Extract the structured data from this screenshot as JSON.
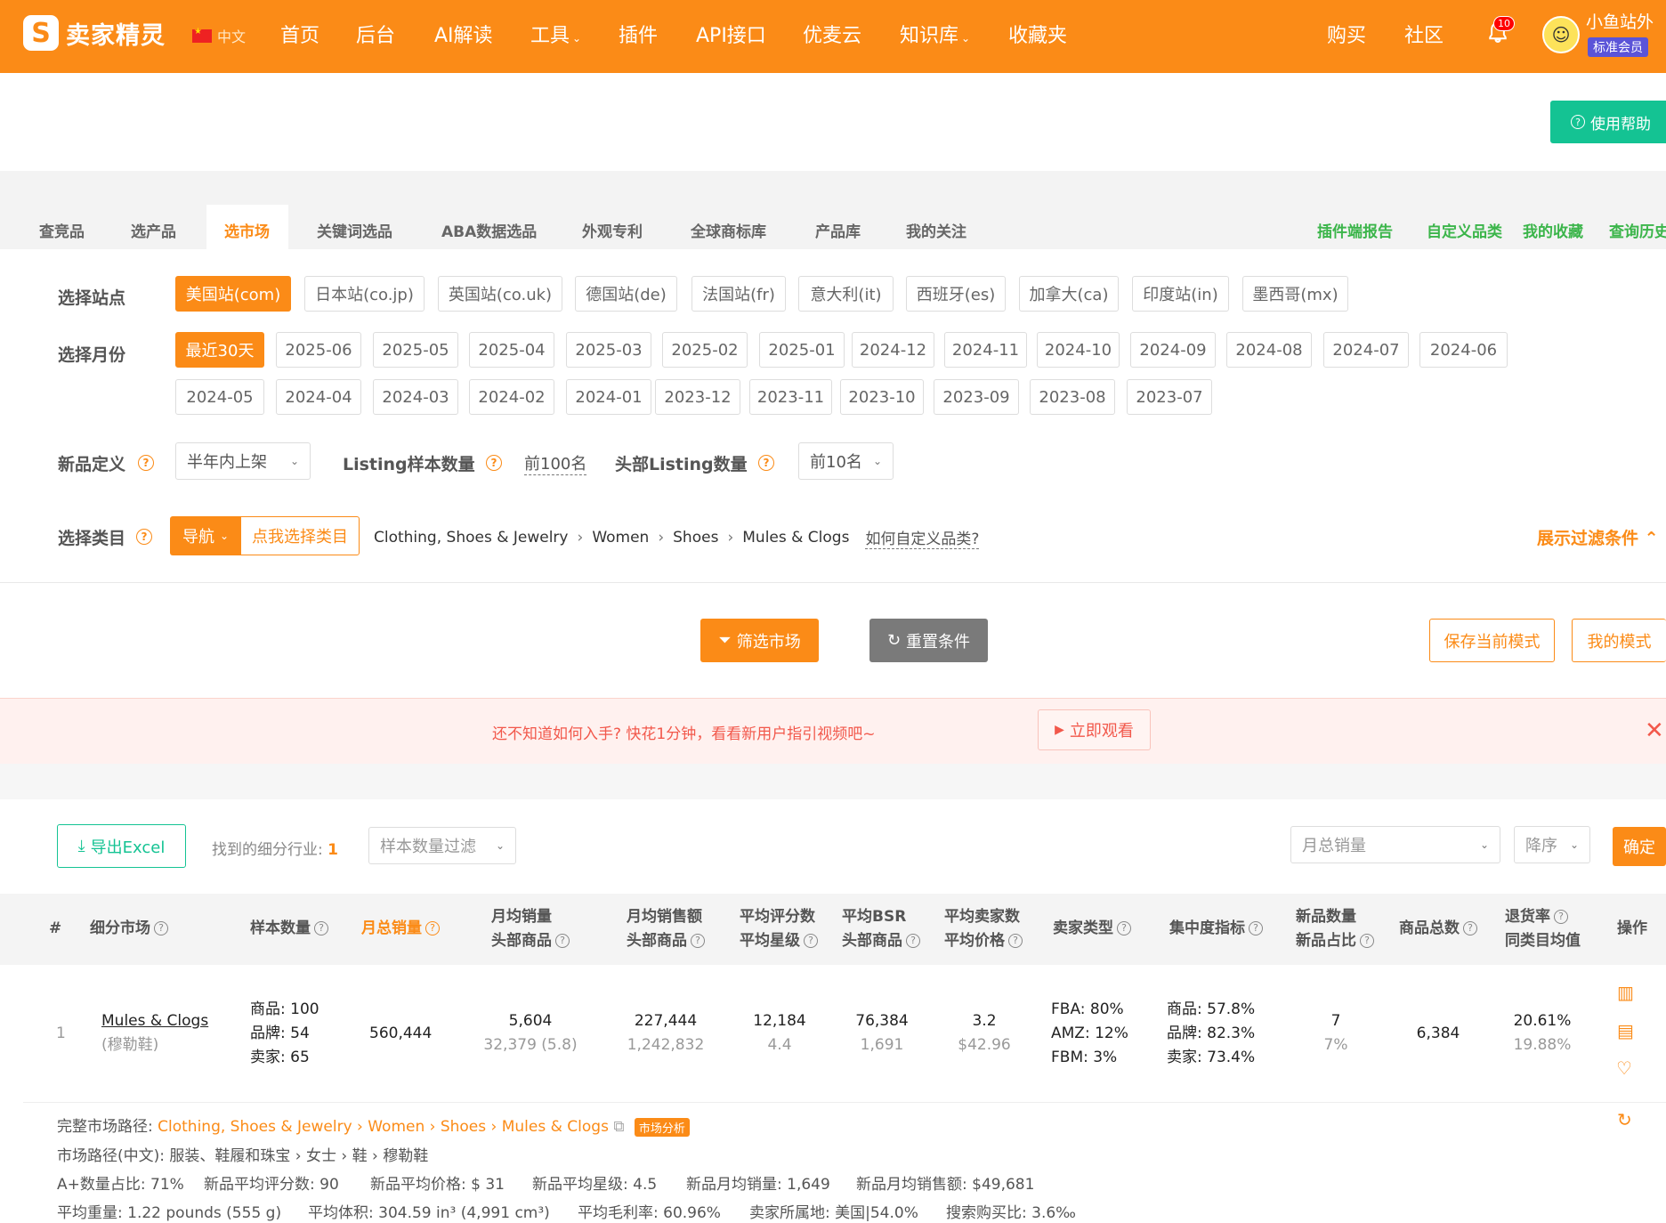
{
  "brand": {
    "name": "卖家精灵",
    "logo_glyph": "S"
  },
  "lang": "中文",
  "nav": {
    "home": "首页",
    "backend": "后台",
    "ai": "AI解读",
    "tools": "工具",
    "plugins": "插件",
    "api": "API接口",
    "youmai": "优麦云",
    "kb": "知识库",
    "favorites": "收藏夹",
    "buy": "购买",
    "community": "社区",
    "notifications": "10",
    "user": "小鱼站外",
    "member": "标准会员"
  },
  "help_label": "使用帮助",
  "tabs": [
    "查竞品",
    "选产品",
    "选市场",
    "关键词选品",
    "ABA数据选品",
    "外观专利",
    "全球商标库",
    "产品库",
    "我的关注"
  ],
  "tabs_right": [
    "插件端报告",
    "自定义品类",
    "我的收藏",
    "查询历史"
  ],
  "filters": {
    "site_label": "选择站点",
    "sites": [
      "美国站(com)",
      "日本站(co.jp)",
      "英国站(co.uk)",
      "德国站(de)",
      "法国站(fr)",
      "意大利(it)",
      "西班牙(es)",
      "加拿大(ca)",
      "印度站(in)",
      "墨西哥(mx)"
    ],
    "month_label": "选择月份",
    "months_row1": [
      "最近30天",
      "2025-06",
      "2025-05",
      "2025-04",
      "2025-03",
      "2025-02",
      "2025-01",
      "2024-12",
      "2024-11",
      "2024-10",
      "2024-09",
      "2024-08",
      "2024-07",
      "2024-06"
    ],
    "months_row2": [
      "2024-05",
      "2024-04",
      "2024-03",
      "2024-02",
      "2024-01",
      "2023-12",
      "2023-11",
      "2023-10",
      "2023-09",
      "2023-08",
      "2023-07"
    ],
    "newdef_label": "新品定义",
    "newdef_value": "半年内上架",
    "listing_sample_label": "Listing样本数量",
    "listing_sample_value": "前100名",
    "top_listing_label": "头部Listing数量",
    "top_listing_value": "前10名",
    "category_label": "选择类目",
    "nav_button": "导航",
    "pick_category": "点我选择类目",
    "breadcrumb": [
      "Clothing, Shoes & Jewelry",
      "Women",
      "Shoes",
      "Mules & Clogs"
    ],
    "custom_category_link": "如何自定义品类?",
    "toggle_filters": "展示过滤条件"
  },
  "buttons": {
    "filter": "筛选市场",
    "reset": "重置条件",
    "save_mode": "保存当前模式",
    "my_mode": "我的模式"
  },
  "notice": {
    "text": "还不知道如何入手? 快花1分钟，看看新用户指引视频吧~",
    "watch": "立即观看"
  },
  "toolbar": {
    "export": "导出Excel",
    "found_label": "找到的细分行业:",
    "found_count": "1",
    "sample_filter_placeholder": "样本数量过滤",
    "sort_field": "月总销量",
    "sort_order": "降序",
    "confirm": "确定"
  },
  "table": {
    "headers": {
      "index": "#",
      "market": "细分市场",
      "sample": "样本数量",
      "monthly_sales": "月总销量",
      "avg_sales_1": "月均销量",
      "avg_sales_2": "头部商品",
      "avg_revenue_1": "月均销售额",
      "avg_revenue_2": "头部商品",
      "avg_reviews_1": "平均评分数",
      "avg_reviews_2": "平均星级",
      "avg_bsr_1": "平均BSR",
      "avg_bsr_2": "头部商品",
      "avg_sellers_1": "平均卖家数",
      "avg_sellers_2": "平均价格",
      "seller_type": "卖家类型",
      "concentration": "集中度指标",
      "new_1": "新品数量",
      "new_2": "新品占比",
      "total_products": "商品总数",
      "return_1": "退货率",
      "return_2": "同类目均值",
      "actions": "操作"
    },
    "row": {
      "index": "1",
      "market_en": "Mules & Clogs",
      "market_cn": "(穆勒鞋)",
      "sample": [
        "商品: 100",
        "品牌: 54",
        "卖家: 65"
      ],
      "monthly_sales": "560,444",
      "avg_sales": "5,604",
      "avg_sales_top": "32,379 (5.8)",
      "avg_revenue": "227,444",
      "avg_revenue_top": "1,242,832",
      "avg_reviews": "12,184",
      "avg_rating": "4.4",
      "avg_bsr": "76,384",
      "avg_bsr_top": "1,691",
      "avg_sellers": "3.2",
      "avg_price": "$42.96",
      "seller_type": [
        "FBA: 80%",
        "AMZ: 12%",
        "FBM: 3%"
      ],
      "concentration": [
        "商品: 57.8%",
        "品牌: 82.3%",
        "卖家: 73.4%"
      ],
      "new_count": "7",
      "new_ratio": "7%",
      "total_products": "6,384",
      "return_rate": "20.61%",
      "return_avg": "19.88%"
    },
    "details": {
      "path_label": "完整市场路径:",
      "path": "Clothing, Shoes & Jewelry › Women › Shoes › Mules & Clogs",
      "market_badge": "市场分析",
      "path_cn": "市场路径(中文): 服装、鞋履和珠宝 › 女士 › 鞋 › 穆勒鞋",
      "stats1": [
        "A+数量占比: 71%",
        "新品平均评分数: 90",
        "新品平均价格: $ 31",
        "新品平均星级: 4.5",
        "新品月均销量: 1,649",
        "新品月均销售额: $49,681"
      ],
      "stats2": [
        "平均重量: 1.22 pounds (555 g)",
        "平均体积: 304.59 in³ (4,991 cm³)",
        "平均毛利率: 60.96%",
        "卖家所属地: 美国|54.0%",
        "搜索购买比: 3.6‰"
      ]
    }
  }
}
